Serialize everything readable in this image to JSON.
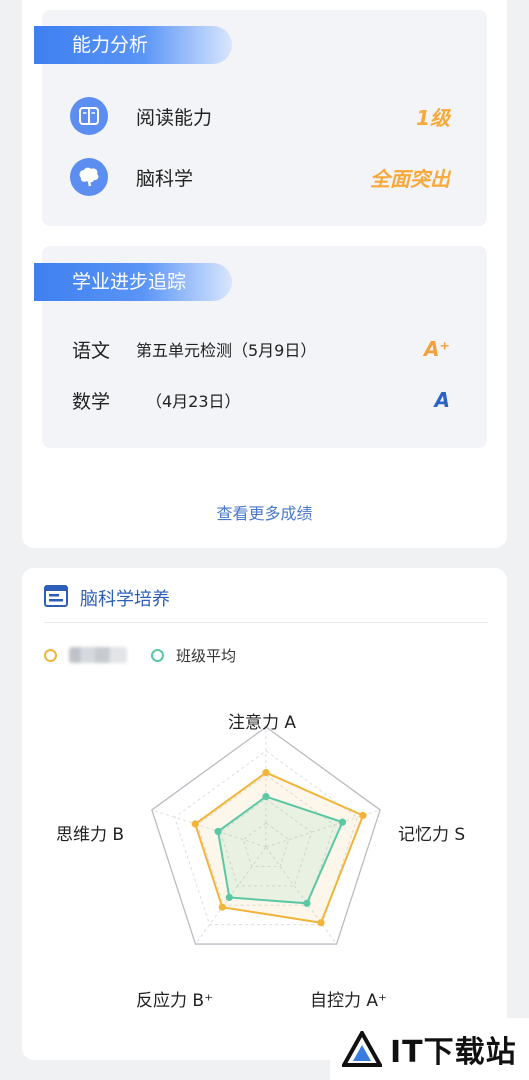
{
  "ability": {
    "title": "能力分析",
    "items": [
      {
        "icon": "book-icon",
        "name": "阅读能力",
        "value": "1级"
      },
      {
        "icon": "brain-icon",
        "name": "脑科学",
        "value": "全面突出"
      }
    ]
  },
  "progress": {
    "title": "学业进步追踪",
    "rows": [
      {
        "subject": "语文",
        "exam": "第五单元检测（5月9日）",
        "grade": "A⁺"
      },
      {
        "subject": "数学",
        "exam": "（4月23日）",
        "grade": "A"
      }
    ]
  },
  "more_link": "查看更多成绩",
  "brain_training": {
    "title": "脑科学培养",
    "legend": {
      "class_avg": "班级平均"
    },
    "colors": {
      "student": "#f0b53a",
      "class_avg": "#5cc7a4",
      "accent": "#3e7ff0"
    }
  },
  "chart_data": {
    "type": "radar",
    "axes": [
      "注意力 A",
      "记忆力 S",
      "自控力 A⁺",
      "反应力 B⁺",
      "思维力 B"
    ],
    "series": [
      {
        "name": "",
        "values": [
          0.62,
          0.85,
          0.78,
          0.62,
          0.62
        ]
      },
      {
        "name": "班级平均",
        "values": [
          0.42,
          0.67,
          0.58,
          0.52,
          0.42
        ]
      }
    ],
    "range": [
      0,
      1
    ],
    "grid_levels": 5
  },
  "watermark": {
    "text": "IT下载站"
  }
}
